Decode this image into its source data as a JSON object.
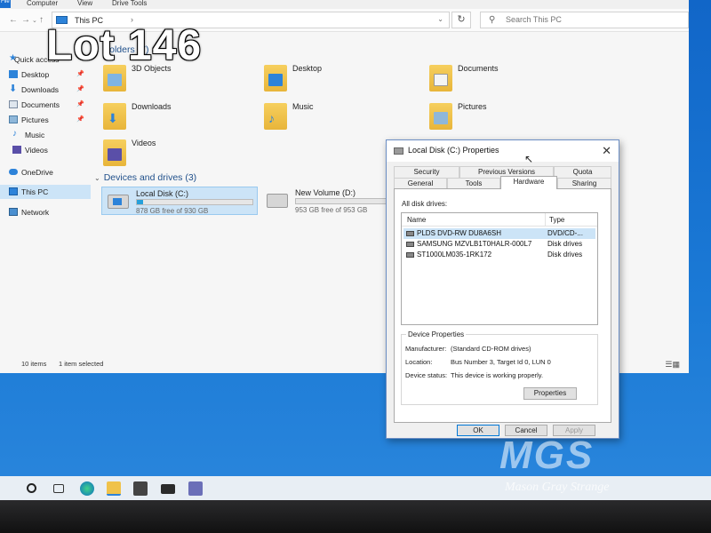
{
  "explorer": {
    "ribbon_tabs": [
      "File",
      "Computer",
      "View",
      "Drive Tools"
    ],
    "address": "This PC",
    "search_placeholder": "Search This PC",
    "nav": {
      "items": [
        {
          "label": "Quick access",
          "pinned": false
        },
        {
          "label": "Desktop",
          "pinned": true
        },
        {
          "label": "Downloads",
          "pinned": true
        },
        {
          "label": "Documents",
          "pinned": true
        },
        {
          "label": "Pictures",
          "pinned": true
        },
        {
          "label": "Music",
          "pinned": false
        },
        {
          "label": "Videos",
          "pinned": false
        },
        {
          "label": "OneDrive",
          "pinned": false
        },
        {
          "label": "This PC",
          "pinned": false
        },
        {
          "label": "Network",
          "pinned": false
        }
      ]
    },
    "folders_header": "Folders (7)",
    "folders": [
      "3D Objects",
      "Desktop",
      "Documents",
      "Downloads",
      "Music",
      "Pictures",
      "Videos"
    ],
    "drives_header": "Devices and drives (3)",
    "drives": [
      {
        "name": "Local Disk (C:)",
        "free": "878 GB free of 930 GB",
        "used_fraction": 0.056
      },
      {
        "name": "New Volume (D:)",
        "free": "953 GB free of 953 GB",
        "used_fraction": 0.0
      }
    ],
    "status": {
      "count": "10 items",
      "selected": "1 item selected"
    }
  },
  "dialog": {
    "title": "Local Disk (C:) Properties",
    "tabs_row1": [
      "Security",
      "Previous Versions",
      "Quota"
    ],
    "tabs_row2": [
      "General",
      "Tools",
      "Hardware",
      "Sharing"
    ],
    "active_tab": "Hardware",
    "all_disks_label": "All disk drives:",
    "columns": {
      "name": "Name",
      "type": "Type"
    },
    "disks": [
      {
        "name": "PLDS DVD-RW DU8A6SH",
        "type": "DVD/CD-..."
      },
      {
        "name": "SAMSUNG MZVLB1T0HALR-000L7",
        "type": "Disk drives"
      },
      {
        "name": "ST1000LM035-1RK172",
        "type": "Disk drives"
      }
    ],
    "device_properties": {
      "legend": "Device Properties",
      "manufacturer_label": "Manufacturer:",
      "manufacturer": "(Standard CD-ROM drives)",
      "location_label": "Location:",
      "location": "Bus Number 3, Target Id 0, LUN 0",
      "status_label": "Device status:",
      "status": "This device is working properly."
    },
    "properties_button": "Properties",
    "ok": "OK",
    "cancel": "Cancel",
    "apply": "Apply"
  },
  "watermark": {
    "lot": "Lot 146",
    "logo": "MGS",
    "tagline": "Mason Gray Strange"
  },
  "colors": {
    "accent": "#0078d7",
    "selection": "#cce4f7",
    "drive_bar": "#26a0da"
  }
}
